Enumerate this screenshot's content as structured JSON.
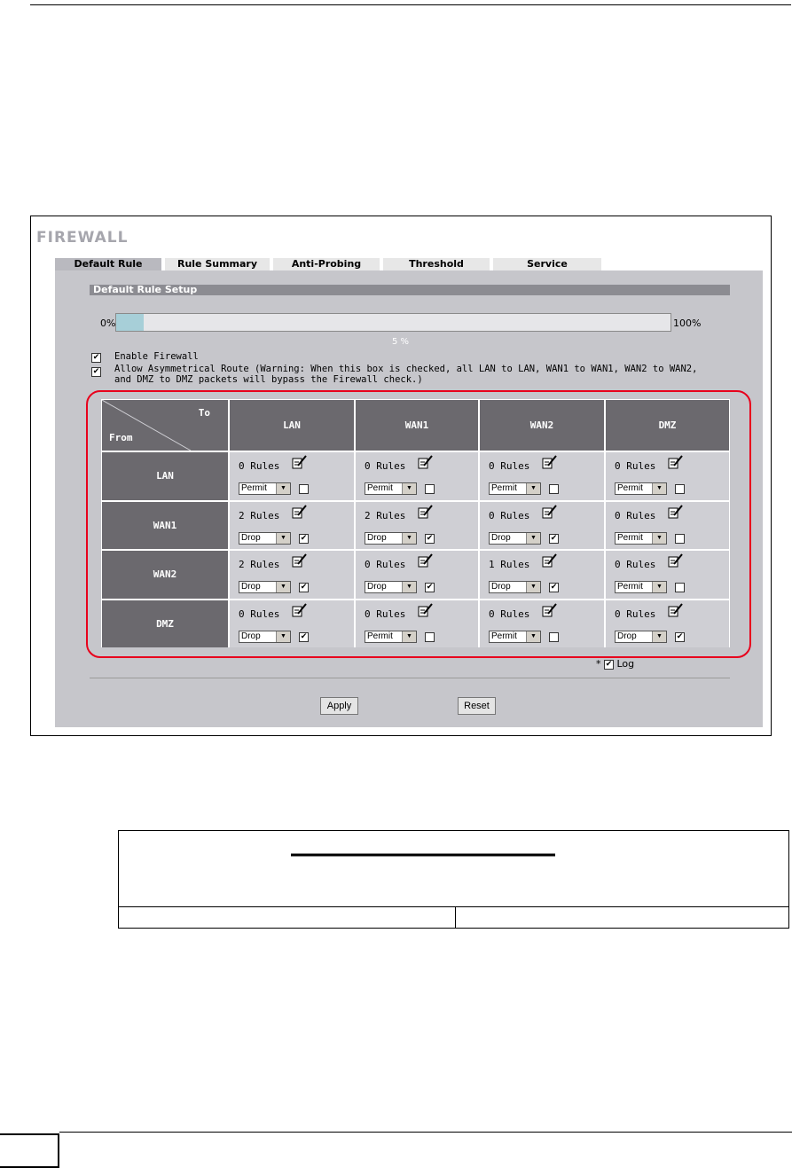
{
  "window": {
    "title": "FIREWALL"
  },
  "tabs": [
    {
      "label": "Default Rule",
      "active": true
    },
    {
      "label": "Rule Summary"
    },
    {
      "label": "Anti-Probing"
    },
    {
      "label": "Threshold"
    },
    {
      "label": "Service"
    }
  ],
  "section": {
    "title": "Default Rule Setup"
  },
  "progress": {
    "min_label": "0%",
    "max_label": "100%",
    "value_label": "5 %",
    "value": 5
  },
  "options": {
    "enable_firewall": {
      "label": "Enable Firewall",
      "checked": true
    },
    "asym_route": {
      "line1": "Allow Asymmetrical Route (Warning: When this box is checked, all LAN to LAN, WAN1 to WAN1, WAN2 to WAN2,",
      "line2": "and DMZ to DMZ packets will bypass the Firewall check.)",
      "checked": true
    }
  },
  "table": {
    "corner_to": "To",
    "corner_from": "From",
    "columns": [
      "LAN",
      "WAN1",
      "WAN2",
      "DMZ"
    ],
    "rules_word": "Rules",
    "rows": [
      {
        "label": "LAN",
        "cells": [
          {
            "count": "0",
            "action": "Permit",
            "log": false
          },
          {
            "count": "0",
            "action": "Permit",
            "log": false
          },
          {
            "count": "0",
            "action": "Permit",
            "log": false
          },
          {
            "count": "0",
            "action": "Permit",
            "log": false
          }
        ]
      },
      {
        "label": "WAN1",
        "cells": [
          {
            "count": "2",
            "action": "Drop",
            "log": true
          },
          {
            "count": "2",
            "action": "Drop",
            "log": true
          },
          {
            "count": "0",
            "action": "Drop",
            "log": true
          },
          {
            "count": "0",
            "action": "Permit",
            "log": false
          }
        ]
      },
      {
        "label": "WAN2",
        "cells": [
          {
            "count": "2",
            "action": "Drop",
            "log": true
          },
          {
            "count": "0",
            "action": "Drop",
            "log": true
          },
          {
            "count": "1",
            "action": "Drop",
            "log": true
          },
          {
            "count": "0",
            "action": "Permit",
            "log": false
          }
        ]
      },
      {
        "label": "DMZ",
        "cells": [
          {
            "count": "0",
            "action": "Drop",
            "log": true
          },
          {
            "count": "0",
            "action": "Permit",
            "log": false
          },
          {
            "count": "0",
            "action": "Permit",
            "log": false
          },
          {
            "count": "0",
            "action": "Drop",
            "log": true
          }
        ]
      }
    ]
  },
  "log_legend": {
    "asterisk": "*",
    "label": "Log",
    "checked": true
  },
  "buttons": {
    "apply": "Apply",
    "reset": "Reset"
  },
  "colors": {
    "highlight_outline": "#e8001c",
    "header_cell": "#6b696e",
    "panel": "#c6c6cb",
    "progress_fill": "#a7cfd8"
  }
}
